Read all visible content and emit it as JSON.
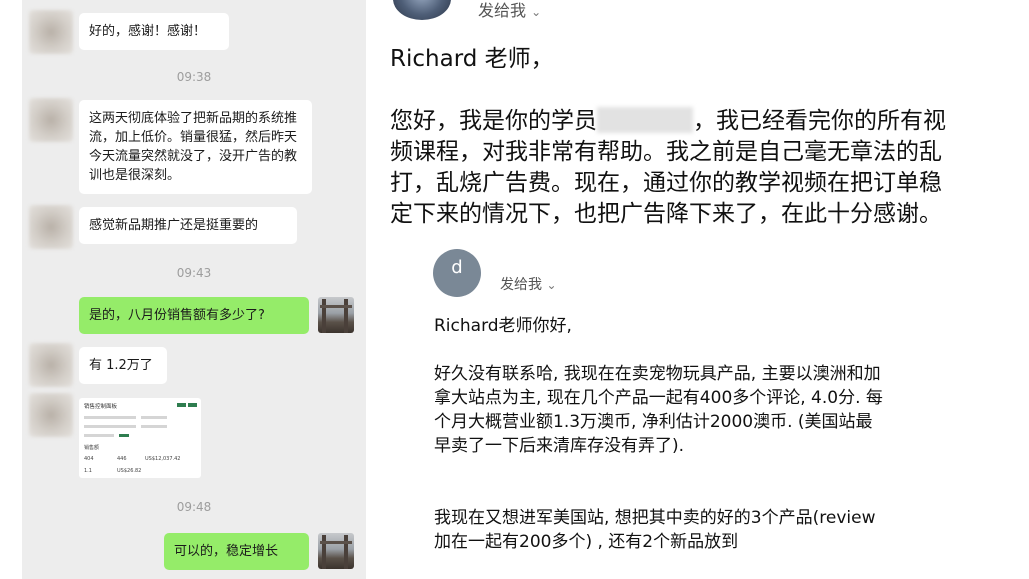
{
  "chat": {
    "msg1": "好的，感谢！感谢！",
    "time1": "09:38",
    "msg2": "这两天彻底体验了把新品期的系统推流，加上低价。销量很猛，然后昨天今天流量突然就没了，没开广告的教训也是很深刻。",
    "msg3": "感觉新品期推广还是挺重要的",
    "time2": "09:43",
    "msg4": "是的，八月份销售额有多少了?",
    "msg5": "有 1.2万了",
    "screenshot": {
      "title": "销售控制面板",
      "label1": "销售额",
      "v1": "404",
      "v2": "446",
      "v3": "US$12,037.42",
      "v4": "1.1",
      "v5": "US$26.82"
    },
    "time3": "09:48",
    "msg6": "可以的，稳定增长"
  },
  "email1": {
    "sender_label": "发给我",
    "greeting": "Richard 老师，",
    "body_before": "您好，我是你的学员",
    "body_after": "，我已经看完你的所有视频课程，对我非常有帮助。我之前是自己毫无章法的乱打，乱烧广告费。现在，通过你的教学视频在把订单稳定下来的情况下，也把广告降下来了，在此十分感谢。"
  },
  "email2": {
    "avatar_letter": "d",
    "sender_label": "发给我",
    "greeting": "Richard老师你好,",
    "para1": "好久没有联系哈, 我现在在卖宠物玩具产品, 主要以澳洲和加拿大站点为主, 现在几个产品一起有400多个评论, 4.0分. 每个月大概营业额1.3万澳币, 净利估计2000澳币. (美国站最早卖了一下后来清库存没有弄了).",
    "para2": "我现在又想进军美国站, 想把其中卖的好的3个产品(review加在一起有200多个) , 还有2个新品放到"
  },
  "icons": [
    "chevron-down-icon"
  ]
}
